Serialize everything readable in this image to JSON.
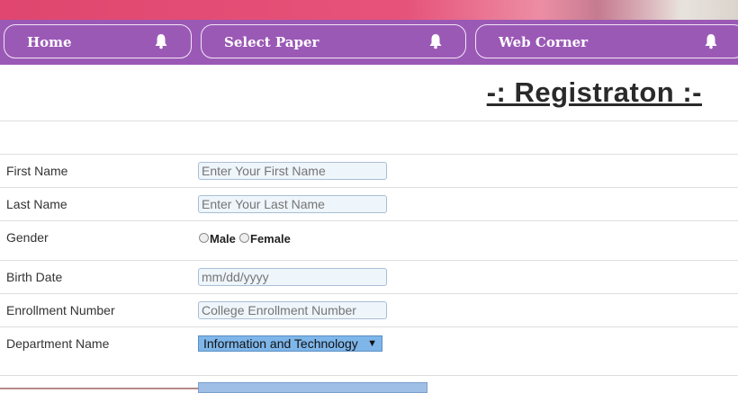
{
  "nav": {
    "items": [
      {
        "label": "Home",
        "icon": "bell-icon"
      },
      {
        "label": "Select Paper",
        "icon": "bell-icon"
      },
      {
        "label": "Web Corner",
        "icon": "bell-icon"
      }
    ]
  },
  "page": {
    "title": "-: Registraton :-"
  },
  "form": {
    "first_name": {
      "label": "First Name",
      "placeholder": "Enter Your First Name"
    },
    "last_name": {
      "label": "Last Name",
      "placeholder": "Enter Your Last Name"
    },
    "gender": {
      "label": "Gender",
      "options": [
        "Male",
        "Female"
      ]
    },
    "birth_date": {
      "label": "Birth Date",
      "placeholder": "mm/dd/yyyy"
    },
    "enrollment": {
      "label": "Enrollment Number",
      "placeholder": "College Enrollment Number"
    },
    "department": {
      "label": "Department Name",
      "selected": "Information and Technology"
    }
  },
  "colors": {
    "nav": "#9b59b6",
    "select": "#7fb6ea"
  }
}
